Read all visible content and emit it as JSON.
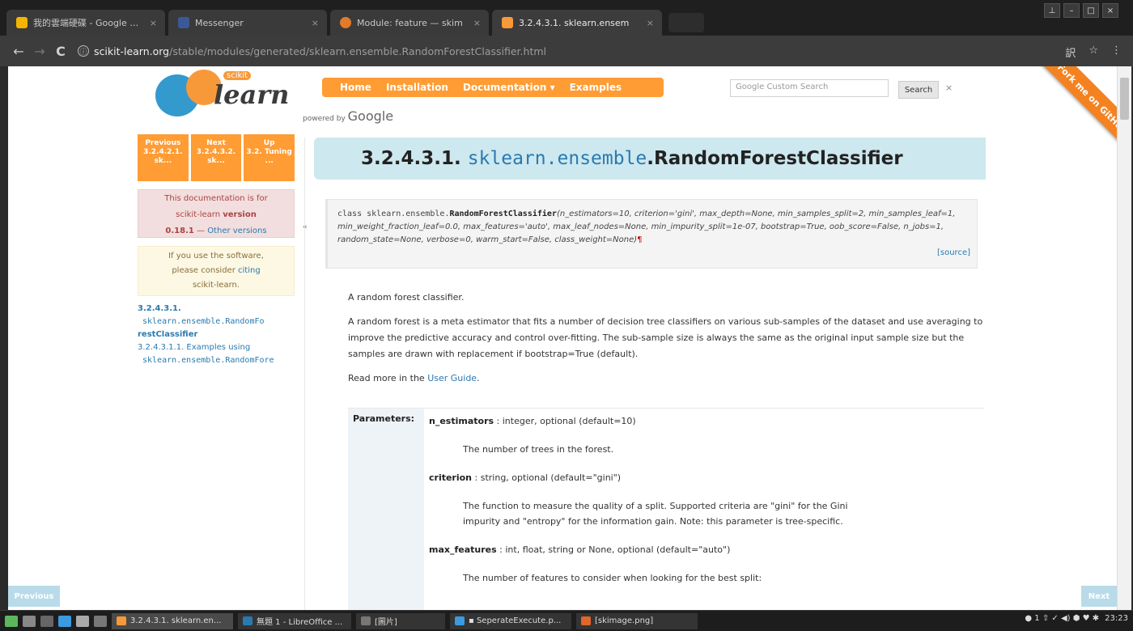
{
  "browser": {
    "tabs": [
      {
        "label": "我的雲端硬碟 - Google 雲端",
        "icon": "drive-icon",
        "color": "#f4b400"
      },
      {
        "label": "Messenger",
        "icon": "facebook-icon",
        "color": "#3b5998"
      },
      {
        "label": "Module: feature — skim",
        "icon": "skimage-icon",
        "color": "#e07b2a"
      },
      {
        "label": "3.2.4.3.1. sklearn.ensem",
        "icon": "sklearn-icon",
        "color": "#f89939"
      }
    ],
    "close_glyph": "×",
    "window_controls": [
      "⊥",
      "–",
      "□",
      "×"
    ],
    "url_host": "scikit-learn.org",
    "url_path": "/stable/modules/generated/sklearn.ensemble.RandomForestClassifier.html",
    "info_glyph": "ⓘ",
    "nav_glyphs": {
      "back": "←",
      "forward": "→",
      "reload": "C"
    },
    "right_glyphs": {
      "translate": "訳",
      "star": "☆",
      "menu": "⋮"
    }
  },
  "site": {
    "logo_small": "scikit",
    "logo_big": "learn",
    "nav": [
      "Home",
      "Installation",
      "Documentation ▾",
      "Examples"
    ],
    "powered_by_prefix": "powered by",
    "powered_by_brand": "Google",
    "search_placeholder": "Google  Custom Search",
    "search_button": "Search",
    "search_clear": "×",
    "ribbon": "Fork me on GitHub"
  },
  "sidebar": {
    "rel": [
      {
        "top": "Previous",
        "sub": "3.2.4.2.1. sk..."
      },
      {
        "top": "Next",
        "sub": "3.2.4.3.2. sk..."
      },
      {
        "top": "Up",
        "sub": "3.2. Tuning ..."
      }
    ],
    "version_line1": "This documentation is for",
    "version_line2a": "scikit-learn ",
    "version_line2b": "version",
    "version_num": "0.18.1",
    "version_sep": " — ",
    "version_link": "Other versions",
    "cite_line1": "If you use the software,",
    "cite_line2a": "please consider ",
    "cite_link": "citing",
    "cite_line3": "scikit-learn.",
    "toc_num": "3.2.4.3.1.",
    "toc_mono": "sklearn.ensemble.RandomFo",
    "toc_tail": "restClassifier",
    "toc_sub": "3.2.4.3.1.1. Examples using",
    "toc_sub_mono": "sklearn.ensemble.RandomFore",
    "collapse": "«"
  },
  "doc": {
    "title_num": "3.2.4.3.1. ",
    "title_mod": "sklearn.ensemble",
    "title_cls": ".RandomForestClassifier",
    "sig_prefix": "class ",
    "sig_mod": "sklearn.ensemble.",
    "sig_cls": "RandomForestClassifier",
    "sig_args": "(n_estimators=10, criterion='gini', max_depth=None, min_samples_split=2, min_samples_leaf=1, min_weight_fraction_leaf=0.0, max_features='auto', max_leaf_nodes=None, min_impurity_split=1e-07, bootstrap=True, oob_score=False, n_jobs=1, random_state=None, verbose=0, warm_start=False, class_weight=None)",
    "pilcrow": "¶",
    "source": "[source]",
    "p1": "A random forest classifier.",
    "p2": "A random forest is a meta estimator that fits a number of decision tree classifiers on various sub-samples of the dataset and use averaging to improve the predictive accuracy and control over-fitting. The sub-sample size is always the same as the original input sample size but the samples are drawn with replacement if bootstrap=True (default).",
    "p3_prefix": "Read more in the ",
    "p3_link": "User Guide",
    "p3_suffix": ".",
    "params_label": "Parameters:",
    "params": [
      {
        "name": "n_estimators",
        "type": " : integer, optional (default=10)",
        "desc": "The number of trees in the forest."
      },
      {
        "name": "criterion",
        "type": " : string, optional (default=\"gini\")",
        "desc": "The function to measure the quality of a split. Supported criteria are \"gini\" for the Gini impurity and \"entropy\" for the information gain. Note: this parameter is tree-specific."
      },
      {
        "name": "max_features",
        "type": " : int, float, string or None, optional (default=\"auto\")",
        "desc": "The number of features to consider when looking for the best split:"
      }
    ],
    "prev_btn": "Previous",
    "next_btn": "Next"
  },
  "taskbar": {
    "items": [
      {
        "label": "3.2.4.3.1. sklearn.en...",
        "color": "#f89939",
        "active": true
      },
      {
        "label": "無題 1 - LibreOffice ...",
        "color": "#2a7ab0",
        "active": false
      },
      {
        "label": "[圖片]",
        "color": "#777777",
        "active": false
      },
      {
        "label": "▪ SeperateExecute.p...",
        "color": "#3c9be0",
        "active": false
      },
      {
        "label": "[skimage.png]",
        "color": "#e0662a",
        "active": false
      }
    ],
    "clock": "23:23",
    "tray_glyphs": "● 1  ⇧  ✓  ◀)  ⬢  ♥  ✱"
  }
}
